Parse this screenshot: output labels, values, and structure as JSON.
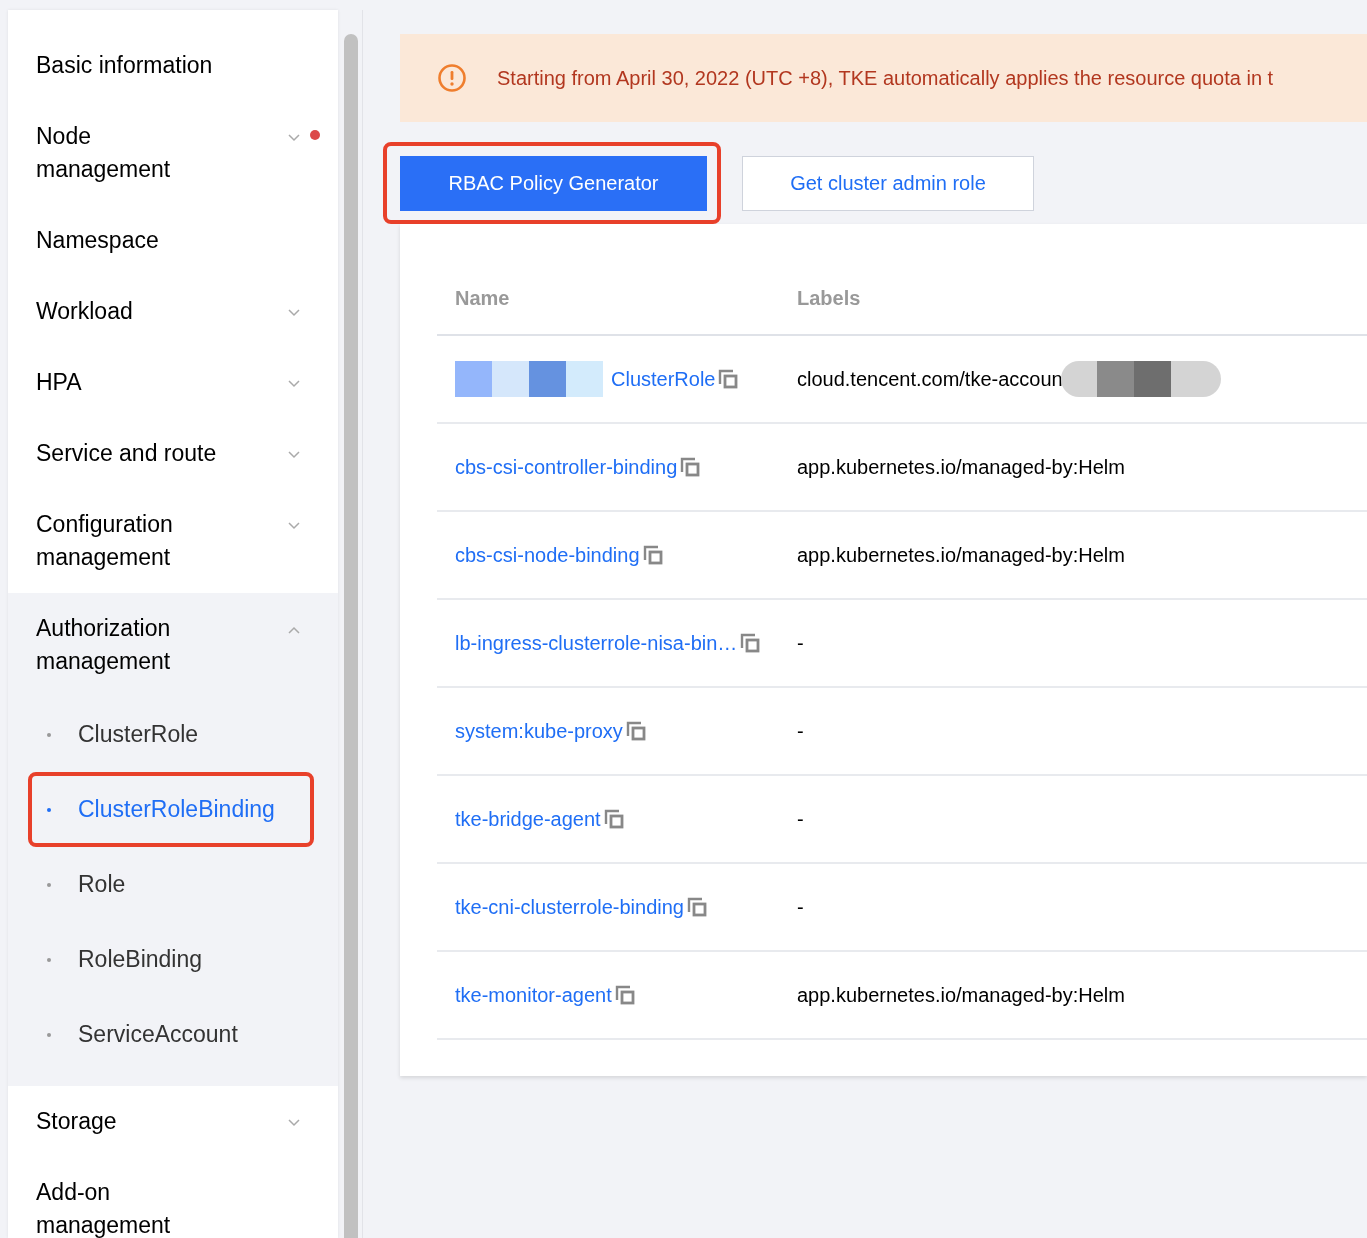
{
  "sidebar": {
    "items": [
      {
        "label": "Basic information",
        "kind": "link",
        "alert_dot": false
      },
      {
        "label": "Node management",
        "kind": "menu",
        "expanded": false,
        "alert_dot": true
      },
      {
        "label": "Namespace",
        "kind": "link",
        "alert_dot": false
      },
      {
        "label": "Workload",
        "kind": "menu",
        "expanded": false,
        "alert_dot": false
      },
      {
        "label": "HPA",
        "kind": "menu",
        "expanded": false,
        "alert_dot": false
      },
      {
        "label": "Service and route",
        "kind": "menu",
        "expanded": false,
        "alert_dot": false
      },
      {
        "label": "Configuration management",
        "kind": "menu",
        "expanded": false,
        "alert_dot": false
      },
      {
        "label": "Authorization management",
        "kind": "menu",
        "expanded": true,
        "alert_dot": false,
        "children": [
          {
            "label": "ClusterRole",
            "selected": false,
            "highlighted": false
          },
          {
            "label": "ClusterRoleBinding",
            "selected": true,
            "highlighted": true
          },
          {
            "label": "Role",
            "selected": false,
            "highlighted": false
          },
          {
            "label": "RoleBinding",
            "selected": false,
            "highlighted": false
          },
          {
            "label": "ServiceAccount",
            "selected": false,
            "highlighted": false
          }
        ]
      },
      {
        "label": "Storage",
        "kind": "menu",
        "expanded": false,
        "alert_dot": false
      },
      {
        "label": "Add-on management",
        "kind": "link",
        "alert_dot": false
      }
    ]
  },
  "notice": {
    "text": "Starting from April 30, 2022 (UTC +8), TKE automatically applies the resource quota in t"
  },
  "buttons": [
    {
      "label": "RBAC Policy Generator",
      "kind": "primary",
      "highlighted": true
    },
    {
      "label": "Get cluster admin role",
      "kind": "secondary",
      "highlighted": false
    }
  ],
  "table": {
    "columns": [
      "Name",
      "Labels"
    ],
    "rows": [
      {
        "name": "ClusterRole",
        "name_redacted": true,
        "labels": "cloud.tencent.com/tke-accoun",
        "labels_redacted": true
      },
      {
        "name": "cbs-csi-controller-binding",
        "name_redacted": false,
        "labels": "app.kubernetes.io/managed-by:Helm",
        "labels_redacted": false
      },
      {
        "name": "cbs-csi-node-binding",
        "name_redacted": false,
        "labels": "app.kubernetes.io/managed-by:Helm",
        "labels_redacted": false
      },
      {
        "name": "lb-ingress-clusterrole-nisa-bin…",
        "name_redacted": false,
        "labels": "-",
        "labels_redacted": false
      },
      {
        "name": "system:kube-proxy",
        "name_redacted": false,
        "labels": "-",
        "labels_redacted": false
      },
      {
        "name": "tke-bridge-agent",
        "name_redacted": false,
        "labels": "-",
        "labels_redacted": false
      },
      {
        "name": "tke-cni-clusterrole-binding",
        "name_redacted": false,
        "labels": "-",
        "labels_redacted": false
      },
      {
        "name": "tke-monitor-agent",
        "name_redacted": false,
        "labels": "app.kubernetes.io/managed-by:Helm",
        "labels_redacted": false
      }
    ]
  }
}
